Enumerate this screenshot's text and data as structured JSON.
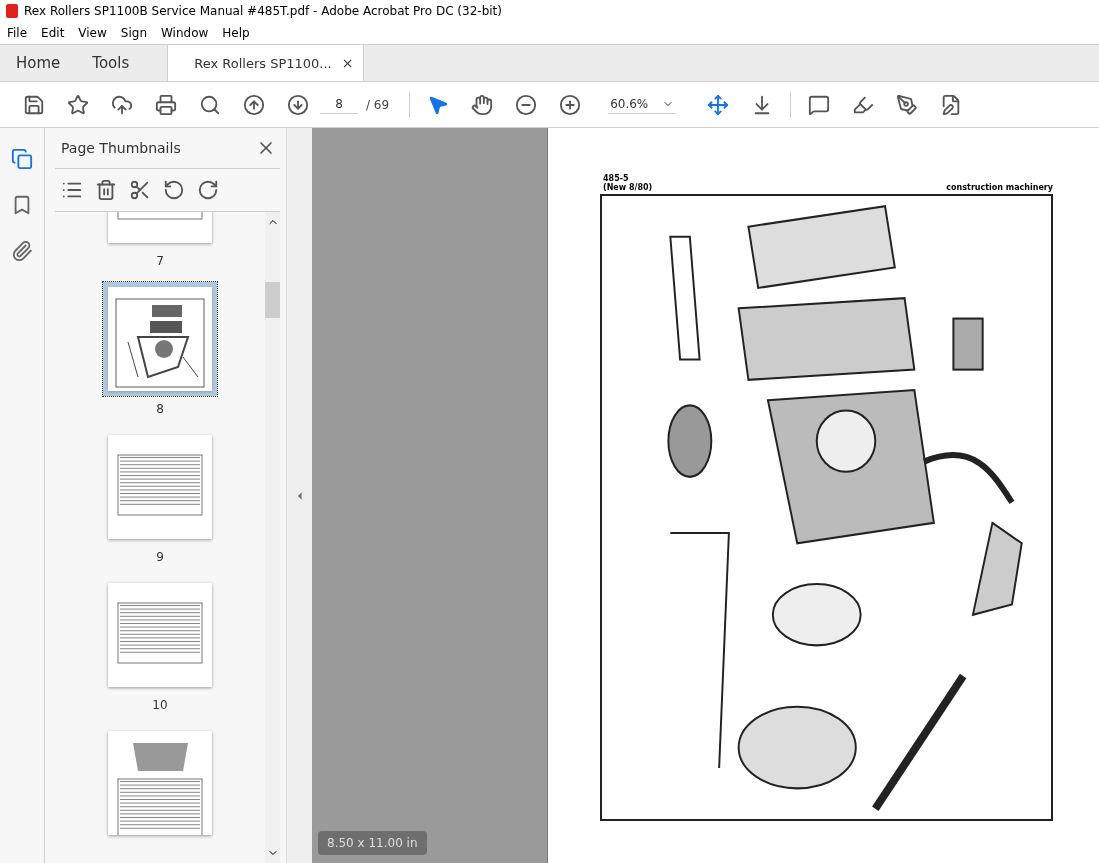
{
  "window": {
    "title": "Rex Rollers SP1100B Service Manual #485T.pdf - Adobe Acrobat Pro DC (32-bit)"
  },
  "menu": [
    "File",
    "Edit",
    "View",
    "Sign",
    "Window",
    "Help"
  ],
  "tabs": [
    {
      "label": "Home",
      "selected": false,
      "kind": "nav"
    },
    {
      "label": "Tools",
      "selected": false,
      "kind": "nav"
    },
    {
      "label": "Rex Rollers SP1100...",
      "selected": true,
      "kind": "document",
      "close": "×"
    }
  ],
  "toolbar": {
    "page": "8",
    "total": "/ 69",
    "zoom": "60.6%",
    "select_tool_selected": true
  },
  "rail": [
    {
      "kind": "pages",
      "selected": true
    },
    {
      "kind": "bookmarks",
      "selected": false
    },
    {
      "kind": "attachments",
      "selected": false
    }
  ],
  "sidebar": {
    "title": "Page Thumbnails",
    "thumbnails": [
      {
        "label": "7",
        "selected": false,
        "kind": "list",
        "cut": true
      },
      {
        "label": "8",
        "selected": true,
        "kind": "diagram"
      },
      {
        "label": "9",
        "selected": false,
        "kind": "list"
      },
      {
        "label": "10",
        "selected": false,
        "kind": "list"
      },
      {
        "selected": false,
        "kind": "mixed"
      }
    ]
  },
  "document": {
    "code": "485-5",
    "revision": "(New 8/80)",
    "publisher": "construction machinery"
  },
  "page_size": "8.50 x 11.00 in"
}
